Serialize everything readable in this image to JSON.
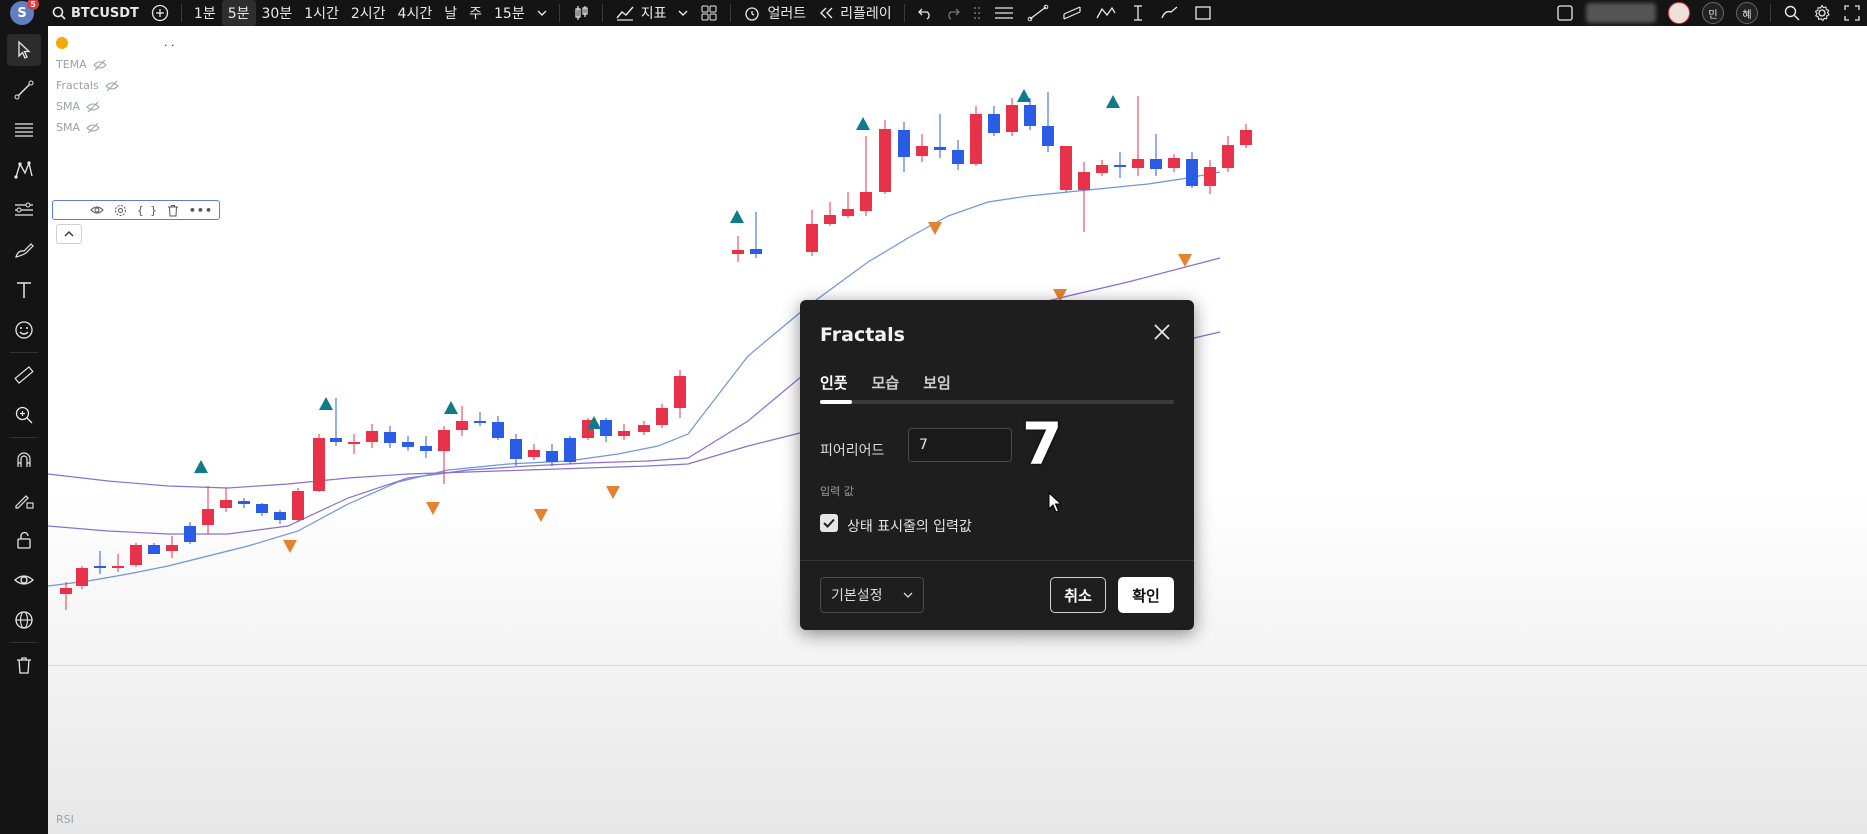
{
  "topbar": {
    "avatar_letter": "S",
    "avatar_badge": "5",
    "symbol": "BTCUSDT",
    "timeframes": [
      "1분",
      "5분",
      "30분",
      "1시간",
      "2시간",
      "4시간",
      "날",
      "주",
      "15분"
    ],
    "active_timeframe_index": 1,
    "indicators_label": "지표",
    "alert_label": "얼러트",
    "replay_label": "리플레이",
    "user_badges": [
      "민",
      "혜"
    ]
  },
  "legend": {
    "symbol_row": ". .",
    "items": [
      "TEMA",
      "Fractals",
      "SMA",
      "SMA"
    ]
  },
  "pane": {
    "rsi_label": "RSI"
  },
  "dialog": {
    "title": "Fractals",
    "tabs": [
      "인풋",
      "모습",
      "보임"
    ],
    "active_tab_index": 0,
    "period_label": "피어리어드",
    "period_value": "7",
    "big_annotation": "7",
    "section_label": "입력 값",
    "checkbox_label": "상태 표시줄의 입력값",
    "checkbox_checked": true,
    "preset_label": "기본설정",
    "cancel_label": "취소",
    "ok_label": "확인"
  },
  "colors": {
    "bull": "#2b5ce6",
    "bear": "#e8324a",
    "fractal_up": "#0f7a8c",
    "fractal_down": "#e6822e",
    "ma_blue": "#6f95e0",
    "ma_purple": "#8a6fd1"
  }
}
